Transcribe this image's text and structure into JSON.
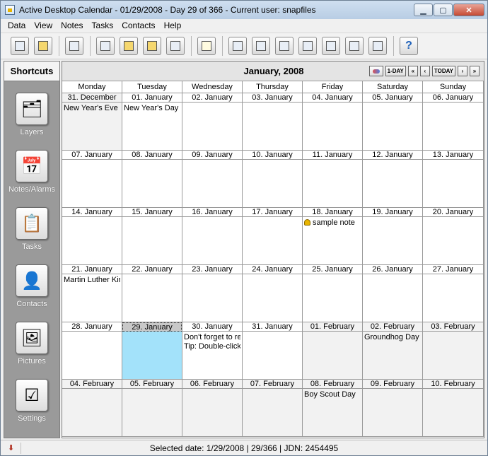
{
  "window": {
    "title": "Active Desktop Calendar - 01/29/2008 - Day 29 of 366 - Current user: snapfiles",
    "buttons": {
      "minimize": "▁",
      "maximize": "▢",
      "close": "✕"
    }
  },
  "menu": [
    "Data",
    "View",
    "Notes",
    "Tasks",
    "Contacts",
    "Help"
  ],
  "toolbar": {
    "buttons": [
      {
        "icon": "calendar-icon"
      },
      {
        "icon": "alarm-icon"
      },
      {
        "icon": "print-icon"
      },
      {
        "icon": "edit-layer-icon"
      },
      {
        "icon": "view-layer-icon"
      },
      {
        "icon": "picture-layer-icon"
      },
      {
        "icon": "delete-layer-icon"
      },
      {
        "icon": "note-icon"
      },
      {
        "icon": "edit-task-icon"
      },
      {
        "icon": "check-task-icon"
      },
      {
        "icon": "move-up-icon"
      },
      {
        "icon": "move-down-icon"
      },
      {
        "icon": "move-top-icon"
      },
      {
        "icon": "move-bottom-icon"
      },
      {
        "icon": "delete-task-icon"
      },
      {
        "icon": "help-icon",
        "label": "?"
      }
    ]
  },
  "sidebar": {
    "header": "Shortcuts",
    "items": [
      {
        "label": "Layers",
        "icon": "layers-icon",
        "glyph": "🗂"
      },
      {
        "label": "Notes/Alarms",
        "icon": "notes-alarms-icon",
        "glyph": "📅"
      },
      {
        "label": "Tasks",
        "icon": "tasks-icon",
        "glyph": "📋"
      },
      {
        "label": "Contacts",
        "icon": "contacts-icon",
        "glyph": "👤"
      },
      {
        "label": "Pictures",
        "icon": "pictures-icon",
        "glyph": "🖼"
      },
      {
        "label": "Settings",
        "icon": "settings-icon",
        "glyph": "☑"
      }
    ]
  },
  "calendar": {
    "month_title": "January, 2008",
    "nav": {
      "one_day": "1-DAY",
      "prev_month": "«",
      "prev": "‹",
      "today": "TODAY",
      "next": "›",
      "next_month": "»"
    },
    "weekdays": [
      "Monday",
      "Tuesday",
      "Wednesday",
      "Thursday",
      "Friday",
      "Saturday",
      "Sunday"
    ],
    "weeks": [
      [
        {
          "date": "31. December",
          "events": [
            "New Year's Eve"
          ],
          "grey": true
        },
        {
          "date": "01. January",
          "events": [
            "New Year's Day"
          ]
        },
        {
          "date": "02. January",
          "events": []
        },
        {
          "date": "03. January",
          "events": []
        },
        {
          "date": "04. January",
          "events": []
        },
        {
          "date": "05. January",
          "events": []
        },
        {
          "date": "06. January",
          "events": []
        }
      ],
      [
        {
          "date": "07. January",
          "events": []
        },
        {
          "date": "08. January",
          "events": []
        },
        {
          "date": "09. January",
          "events": []
        },
        {
          "date": "10. January",
          "events": []
        },
        {
          "date": "11. January",
          "events": []
        },
        {
          "date": "12. January",
          "events": []
        },
        {
          "date": "13. January",
          "events": []
        }
      ],
      [
        {
          "date": "14. January",
          "events": []
        },
        {
          "date": "15. January",
          "events": []
        },
        {
          "date": "16. January",
          "events": []
        },
        {
          "date": "17. January",
          "events": []
        },
        {
          "date": "18. January",
          "events": [
            "sample note"
          ],
          "alarm": true
        },
        {
          "date": "19. January",
          "events": []
        },
        {
          "date": "20. January",
          "events": []
        }
      ],
      [
        {
          "date": "21. January",
          "events": [
            "Martin Luther King,"
          ]
        },
        {
          "date": "22. January",
          "events": []
        },
        {
          "date": "23. January",
          "events": []
        },
        {
          "date": "24. January",
          "events": []
        },
        {
          "date": "25. January",
          "events": []
        },
        {
          "date": "26. January",
          "events": []
        },
        {
          "date": "27. January",
          "events": []
        }
      ],
      [
        {
          "date": "28. January",
          "events": []
        },
        {
          "date": "29. January",
          "events": [],
          "selected": true
        },
        {
          "date": "30. January",
          "events": [
            "Don't forget to regis",
            "Tip: Double-click he"
          ]
        },
        {
          "date": "31. January",
          "events": []
        },
        {
          "date": "01. February",
          "events": [],
          "grey": true
        },
        {
          "date": "02. February",
          "events": [
            "Groundhog Day"
          ],
          "grey": true
        },
        {
          "date": "03. February",
          "events": [],
          "grey": true
        }
      ],
      [
        {
          "date": "04. February",
          "events": [],
          "grey": true
        },
        {
          "date": "05. February",
          "events": [],
          "grey": true
        },
        {
          "date": "06. February",
          "events": [],
          "grey": true
        },
        {
          "date": "07. February",
          "events": [],
          "grey": true
        },
        {
          "date": "08. February",
          "events": [
            "Boy Scout Day"
          ],
          "grey": true
        },
        {
          "date": "09. February",
          "events": [],
          "grey": true
        },
        {
          "date": "10. February",
          "events": [],
          "grey": true
        }
      ]
    ]
  },
  "statusbar": {
    "text": "Selected date: 1/29/2008 | 29/366 | JDN: 2454495",
    "icon": "download-icon"
  }
}
